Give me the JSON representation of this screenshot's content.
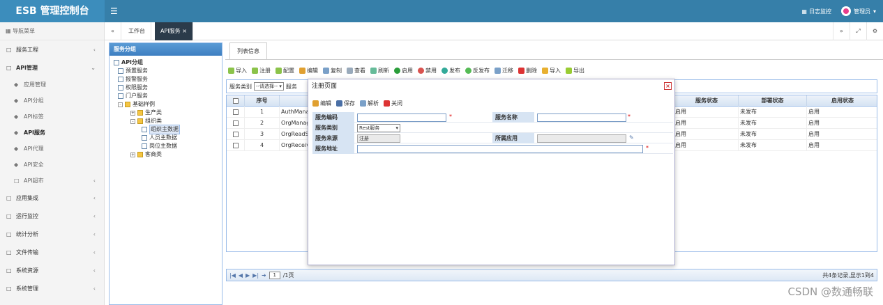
{
  "app": {
    "title": "ESB 管理控制台"
  },
  "header": {
    "menu_icon": "menu-icon",
    "monitor_label": "日志监控",
    "user_label": "管理员"
  },
  "nav": {
    "header": "导航菜单",
    "groups": [
      {
        "label": "服务工程"
      },
      {
        "label": "API管理"
      },
      {
        "label": "应用集成"
      },
      {
        "label": "运行监控"
      },
      {
        "label": "统计分析"
      },
      {
        "label": "文件传输"
      },
      {
        "label": "系统资源"
      },
      {
        "label": "系统管理"
      }
    ],
    "api_sub": [
      {
        "label": "应用管理"
      },
      {
        "label": "API分组"
      },
      {
        "label": "API标签"
      },
      {
        "label": "API服务"
      },
      {
        "label": "API代理"
      },
      {
        "label": "API安全"
      },
      {
        "label": "API超市"
      }
    ]
  },
  "tabs": {
    "home": "工作台",
    "active": "API服务"
  },
  "tree_panel": {
    "title": "服务分组",
    "nodes": {
      "root": "API分组",
      "n1": "预置服务",
      "n2": "报警服务",
      "n3": "权限服务",
      "n4": "门户服务",
      "n5": "基础样例",
      "n6": "生产类",
      "n7": "组织类",
      "n8": "组织主数据",
      "n9": "人员主数据",
      "n10": "岗位主数据",
      "n11": "客商类"
    }
  },
  "content": {
    "tab_label": "列表信息",
    "toolbar": {
      "import": "导入",
      "register": "注册",
      "config": "配置",
      "edit": "编辑",
      "copy": "复制",
      "view": "查看",
      "refresh": "刷新",
      "enable": "启用",
      "disable": "禁用",
      "publish": "发布",
      "unpublish": "反发布",
      "migrate": "迁移",
      "delete": "删除",
      "import2": "导入",
      "export": "导出"
    },
    "filter": {
      "label": "服务类别",
      "select_value": "--请选择--",
      "label2": "服务"
    },
    "grid": {
      "headers": {
        "seq": "序号",
        "service_status": "服务状态",
        "deploy_status": "部署状态",
        "enable_status": "启用状态"
      },
      "rows": [
        {
          "seq": "1",
          "code": "AuthMana",
          "service_status": "启用",
          "deploy_status": "未发布",
          "enable_status": "启用"
        },
        {
          "seq": "2",
          "code": "OrgManag",
          "service_status": "启用",
          "deploy_status": "未发布",
          "enable_status": "启用"
        },
        {
          "seq": "3",
          "code": "OrgReadS",
          "service_status": "启用",
          "deploy_status": "未发布",
          "enable_status": "启用"
        },
        {
          "seq": "4",
          "code": "OrgReceiv",
          "service_status": "启用",
          "deploy_status": "未发布",
          "enable_status": "启用"
        }
      ]
    },
    "pager": {
      "page_value": "1",
      "page_total": "/1页",
      "summary": "共4条记录,显示1到4"
    }
  },
  "dialog": {
    "title": "注册页面",
    "toolbar": {
      "edit": "编辑",
      "save": "保存",
      "parse": "解析",
      "close": "关闭"
    },
    "form": {
      "code_label": "服务编码",
      "name_label": "服务名称",
      "type_label": "服务类别",
      "type_value": "Rest服务",
      "source_label": "服务来源",
      "source_value": "注册",
      "app_label": "所属应用",
      "addr_label": "服务地址",
      "required_mark": "*"
    }
  },
  "watermark": "CSDN @数通畅联"
}
